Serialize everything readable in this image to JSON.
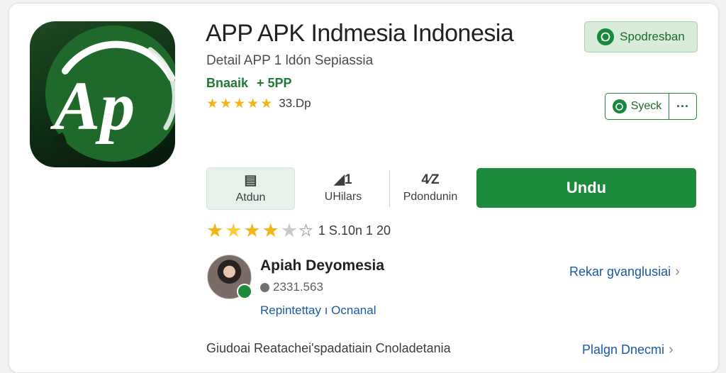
{
  "app": {
    "title": "APP APK Indmesia  Indonesia",
    "subtitle": "Detail  APP 1 ldón Sepiassia",
    "developer": "Bnaaik",
    "developer_extra": "+ 5PP",
    "icon_text": "Ap",
    "rating_small": "33.Dp",
    "rating_small_stars": 5
  },
  "buttons": {
    "share_label": "Spodresban",
    "secondary_label": "Syeck",
    "more_label": "···",
    "install_label": "Undu"
  },
  "stats": [
    {
      "icon": "▤",
      "label": "Atdun"
    },
    {
      "icon": "◢1",
      "label": "UHilars"
    },
    {
      "icon": "4⁄Z",
      "label": "Pdondunin"
    }
  ],
  "rating": {
    "value": "1 S.10n 1 20",
    "stars_full": 4,
    "stars_empty": 2
  },
  "review": {
    "name": "Apiah Deyomesia",
    "meta": "2331.563",
    "link": "Repintettay ı Ocnanal",
    "side_link": "Rekar gvanglusiai"
  },
  "footer": {
    "text": "Giudoai Reatachei'spadatiain Cnoladetania",
    "side_link": "Plalgn Dnecmi"
  },
  "colors": {
    "brand_green": "#1e8a3c",
    "link_blue": "#1a59a8",
    "star_gold": "#f2b417"
  }
}
